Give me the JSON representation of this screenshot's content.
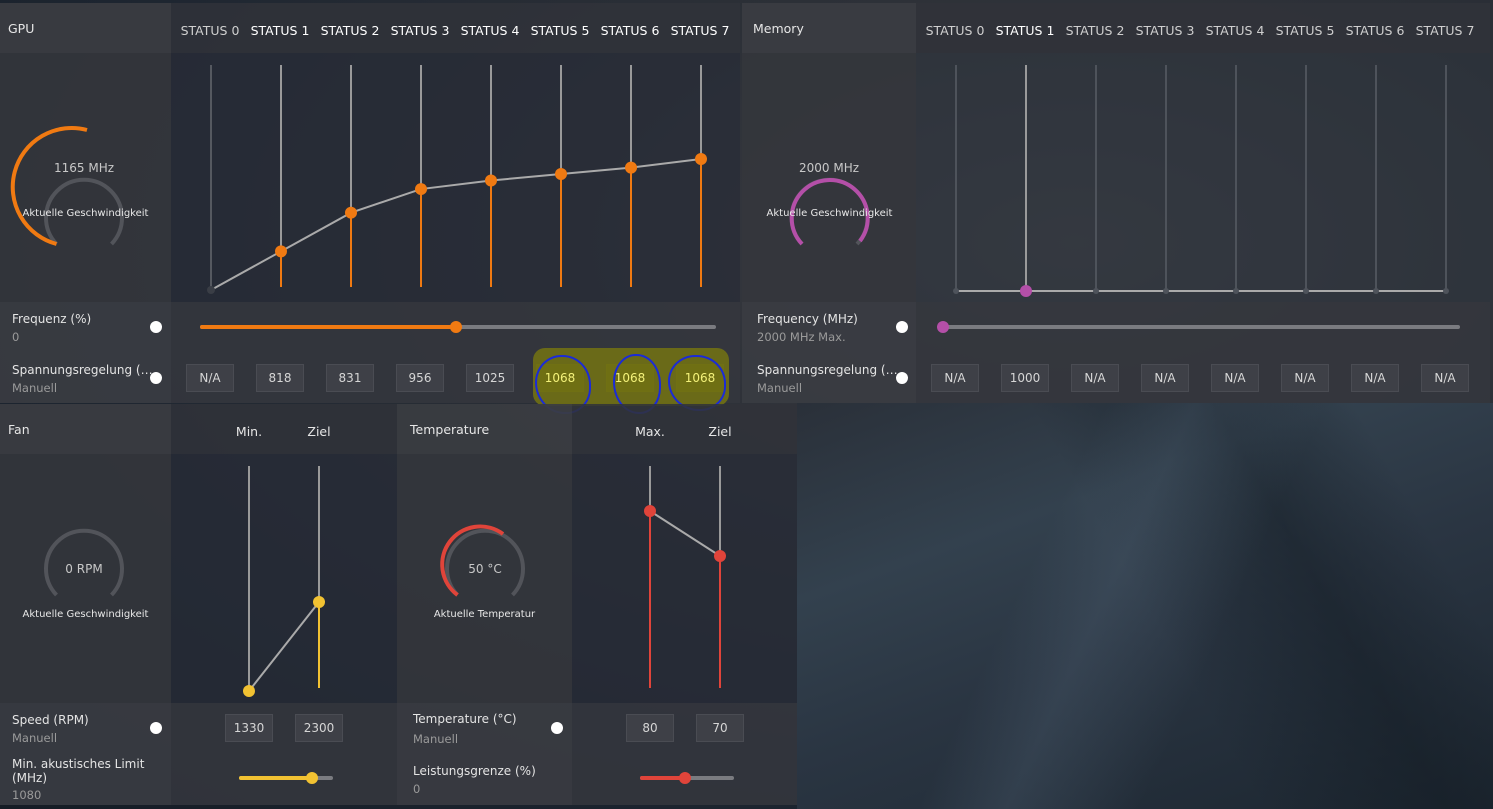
{
  "gpu": {
    "title": "GPU",
    "states": [
      "STATUS 0",
      "STATUS 1",
      "STATUS 2",
      "STATUS 3",
      "STATUS 4",
      "STATUS 5",
      "STATUS 6",
      "STATUS 7"
    ],
    "gauge_value": "1165 MHz",
    "gauge_label": "Aktuelle Geschwindigkeit",
    "frequency_label": "Frequenz (%)",
    "frequency_value": "0",
    "frequency_slider_fraction": 0.5,
    "voltage_label": "Spannungsregelung (…",
    "voltage_mode": "Manuell",
    "voltages": [
      "N/A",
      "818",
      "831",
      "956",
      "1025",
      "1068",
      "1068",
      "1068"
    ],
    "state_levels": [
      0.0,
      0.18,
      0.36,
      0.47,
      0.51,
      0.54,
      0.57,
      0.61
    ],
    "accent": "#f07a12"
  },
  "memory": {
    "title": "Memory",
    "states": [
      "STATUS 0",
      "STATUS 1",
      "STATUS 2",
      "STATUS 3",
      "STATUS 4",
      "STATUS 5",
      "STATUS 6",
      "STATUS 7"
    ],
    "gauge_value": "2000 MHz",
    "gauge_label": "Aktuelle Geschwindigkeit",
    "frequency_label": "Frequency (MHz)",
    "frequency_value": "2000 MHz Max.",
    "voltage_label": "Spannungsregelung (…",
    "voltage_mode": "Manuell",
    "voltages": [
      "N/A",
      "1000",
      "N/A",
      "N/A",
      "N/A",
      "N/A",
      "N/A",
      "N/A"
    ],
    "accent": "#b44fa8"
  },
  "fan": {
    "title": "Fan",
    "col_min": "Min.",
    "col_target": "Ziel",
    "gauge_value": "0 RPM",
    "gauge_label": "Aktuelle Geschwindigkeit",
    "speed_label": "Speed (RPM)",
    "speed_mode": "Manuell",
    "min_value": "1330",
    "target_value": "2300",
    "acoustic_label_1": "Min. akustisches Limit",
    "acoustic_label_2": "(MHz)",
    "acoustic_value": "1080",
    "acoustic_slider_fraction": 0.78,
    "accent": "#f2c232"
  },
  "temperature": {
    "title": "Temperature",
    "col_max": "Max.",
    "col_target": "Ziel",
    "gauge_value": "50 °C",
    "gauge_label": "Aktuelle Temperatur",
    "temp_label": "Temperature (°C)",
    "temp_mode": "Manuell",
    "max_value": "80",
    "target_value": "70",
    "power_label": "Leistungsgrenze (%)",
    "power_value": "0",
    "power_slider_fraction": 0.47,
    "accent": "#e0443a"
  }
}
